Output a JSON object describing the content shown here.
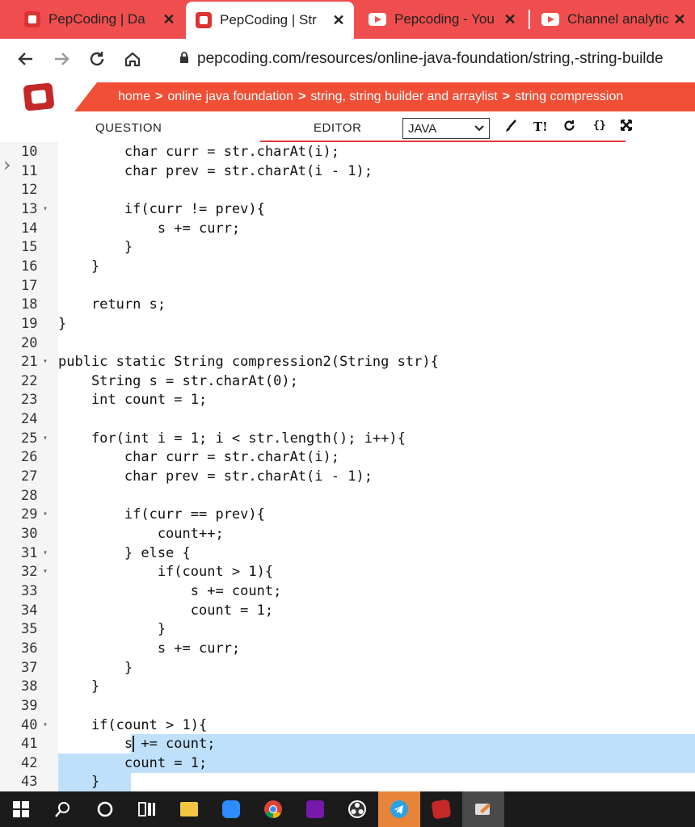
{
  "browser": {
    "tabs": [
      {
        "title": "PepCoding | Da",
        "icon": "pepcoding-favicon",
        "active": false
      },
      {
        "title": "PepCoding | Str",
        "icon": "pepcoding-favicon",
        "active": true
      },
      {
        "title": "Pepcoding - You",
        "icon": "youtube-favicon",
        "active": false
      },
      {
        "title": "Channel analytic",
        "icon": "youtube-favicon",
        "active": false
      }
    ],
    "close_glyph": "✕",
    "url": "pepcoding.com/resources/online-java-foundation/string,-string-builde"
  },
  "breadcrumb": [
    "home",
    "online java foundation",
    "string, string builder and arraylist",
    "string compression"
  ],
  "breadcrumb_separator": ">",
  "editor": {
    "question_tab": "QUESTION",
    "editor_tab": "EDITOR",
    "language": "JAVA",
    "tools": [
      "brush-icon",
      "font-size-icon",
      "reset-icon",
      "format-braces-icon",
      "fullscreen-icon"
    ]
  },
  "code_lines": [
    {
      "n": "10",
      "text": "        char curr = str.charAt(i);",
      "fold": false
    },
    {
      "n": "11",
      "text": "        char prev = str.charAt(i - 1);",
      "fold": false
    },
    {
      "n": "12",
      "text": "",
      "fold": false
    },
    {
      "n": "13",
      "text": "        if(curr != prev){",
      "fold": true
    },
    {
      "n": "14",
      "text": "            s += curr;",
      "fold": false
    },
    {
      "n": "15",
      "text": "        }",
      "fold": false
    },
    {
      "n": "16",
      "text": "    }",
      "fold": false
    },
    {
      "n": "17",
      "text": "",
      "fold": false
    },
    {
      "n": "18",
      "text": "    return s;",
      "fold": false
    },
    {
      "n": "19",
      "text": "}",
      "fold": false
    },
    {
      "n": "20",
      "text": "",
      "fold": false
    },
    {
      "n": "21",
      "text": "public static String compression2(String str){",
      "fold": true
    },
    {
      "n": "22",
      "text": "    String s = str.charAt(0);",
      "fold": false
    },
    {
      "n": "23",
      "text": "    int count = 1;",
      "fold": false
    },
    {
      "n": "24",
      "text": "",
      "fold": false
    },
    {
      "n": "25",
      "text": "    for(int i = 1; i < str.length(); i++){",
      "fold": true
    },
    {
      "n": "26",
      "text": "        char curr = str.charAt(i);",
      "fold": false
    },
    {
      "n": "27",
      "text": "        char prev = str.charAt(i - 1);",
      "fold": false
    },
    {
      "n": "28",
      "text": "",
      "fold": false
    },
    {
      "n": "29",
      "text": "        if(curr == prev){",
      "fold": true
    },
    {
      "n": "30",
      "text": "            count++;",
      "fold": false
    },
    {
      "n": "31",
      "text": "        } else {",
      "fold": true
    },
    {
      "n": "32",
      "text": "            if(count > 1){",
      "fold": true
    },
    {
      "n": "33",
      "text": "                s += count;",
      "fold": false
    },
    {
      "n": "34",
      "text": "                count = 1;",
      "fold": false
    },
    {
      "n": "35",
      "text": "            }",
      "fold": false
    },
    {
      "n": "36",
      "text": "            s += curr;",
      "fold": false
    },
    {
      "n": "37",
      "text": "        }",
      "fold": false
    },
    {
      "n": "38",
      "text": "    }",
      "fold": false
    },
    {
      "n": "39",
      "text": "",
      "fold": false
    },
    {
      "n": "40",
      "text": "    if(count > 1){",
      "fold": true
    },
    {
      "n": "41",
      "text": "        s += count;",
      "fold": false
    },
    {
      "n": "42",
      "text": "        count = 1;",
      "fold": false
    },
    {
      "n": "43",
      "text": "    }",
      "fold": false
    }
  ],
  "taskbar": [
    "windows-start-icon",
    "search-icon",
    "cortana-icon",
    "task-view-icon",
    "file-explorer-icon",
    "zoom-icon",
    "chrome-icon",
    "onenote-icon",
    "obs-icon",
    "telegram-icon",
    "pepcoding-app-icon",
    "screen-annotate-icon"
  ],
  "colors": {
    "accent": "#f04e4e",
    "selection": "#bfe0fb",
    "taskbar": "#1b1b1b"
  }
}
